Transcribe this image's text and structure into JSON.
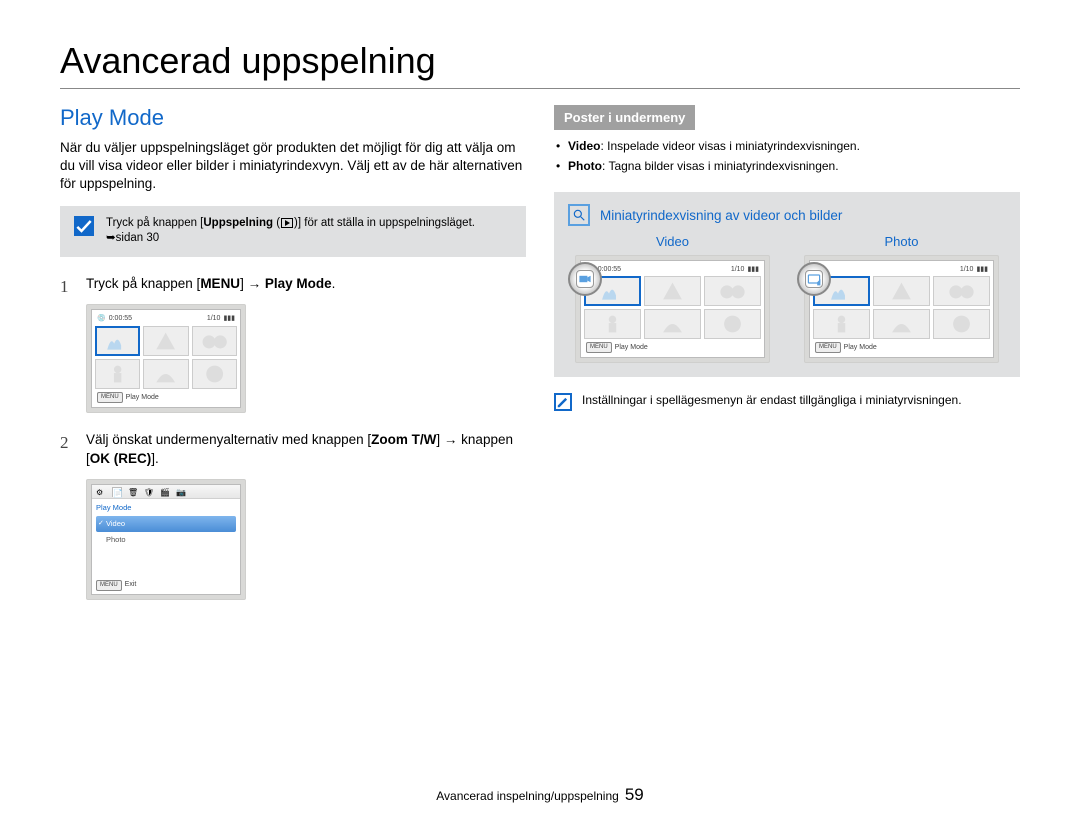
{
  "page_title": "Avancerad uppspelning",
  "section": "Play Mode",
  "intro": "När du väljer uppspelningsläget gör produkten det möjligt för dig att välja om du vill visa videor eller bilder i miniatyrindexvyn. Välj ett av de här alternativen för uppspelning.",
  "note1_a": "Tryck på knappen [",
  "note1_b": "Uppspelning",
  "note1_c": " (",
  "note1_d": ")] för att ställa in uppspelningsläget. ",
  "note1_arrow": "➥",
  "note1_e": "sidan 30",
  "step1_a": "Tryck på knappen [",
  "step1_b": "MENU",
  "step1_c": "] ",
  "step1_arrow": "→",
  "step1_d": " Play Mode",
  "step1_e": ".",
  "step2_a": "Välj önskat undermenyalternativ med knappen [",
  "step2_b": "Zoom T/W",
  "step2_c": "] ",
  "step2_arrow": "→",
  "step2_d": " knappen [",
  "step2_e": "OK (REC)",
  "step2_f": "].",
  "lcd1": {
    "time": "0:00:55",
    "count": "1/10",
    "footer": "Play Mode"
  },
  "lcd_menu": {
    "title": "Play Mode",
    "opt1": "Video",
    "opt2": "Photo",
    "footer": "Exit"
  },
  "submenu_header": "Poster i undermeny",
  "bullets": [
    {
      "b": "Video",
      "t": ": Inspelade videor visas i miniatyrindexvisningen."
    },
    {
      "b": "Photo",
      "t": ": Tagna bilder visas i miniatyrindexvisningen."
    }
  ],
  "info_title": "Miniatyrindexvisning av videor och bilder",
  "video_label": "Video",
  "photo_label": "Photo",
  "lcd_video": {
    "time": "0:00:55",
    "count": "1/10",
    "footer": "Play Mode"
  },
  "lcd_photo": {
    "count": "1/10",
    "footer": "Play Mode"
  },
  "tip2": "Inställningar i spellägesmenyn är endast tillgängliga i miniatyrvisningen.",
  "footer_chapter": "Avancerad inspelning/uppspelning",
  "footer_page": "59"
}
